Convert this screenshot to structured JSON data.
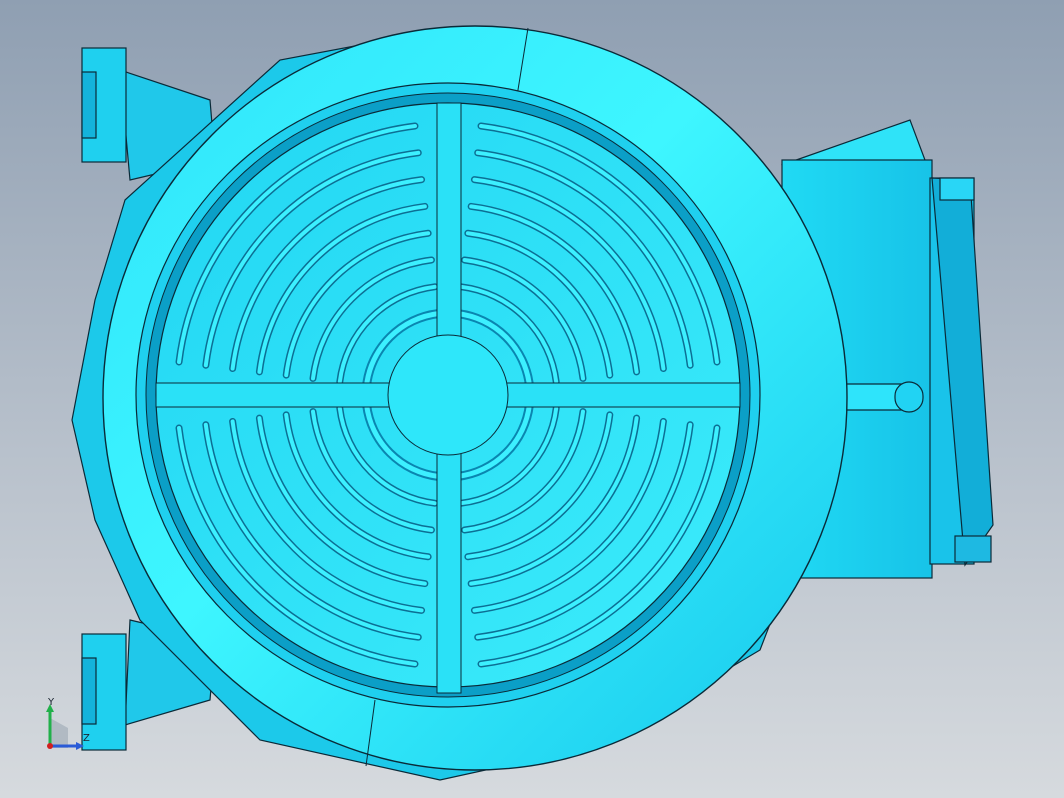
{
  "viewport": {
    "background_top": "#8f9fb2",
    "background_bottom": "#d6dade"
  },
  "model": {
    "kind": "motor-fan-cover-top-view",
    "body_color": "#1ed2f0",
    "highlight_color": "#46faff",
    "shadow_color": "#0a94bc",
    "edge_color": "#0a2a38",
    "grille_ring_count": 9,
    "grille_spokes": 4
  },
  "triad": {
    "y_label": "Y",
    "z_label": "Z",
    "x_color": "#d21e1e",
    "y_color": "#21b04a",
    "z_color": "#2a5bd7"
  }
}
